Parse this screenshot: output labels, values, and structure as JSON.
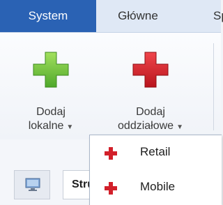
{
  "tabs": [
    "System",
    "Główne",
    "Sp"
  ],
  "ribbon": {
    "add_local": {
      "line1": "Dodaj",
      "line2": "lokalne",
      "arrow": "▼",
      "icon": "green-plus-icon"
    },
    "add_branch": {
      "line1": "Dodaj",
      "line2": "oddziałowe",
      "arrow": "▼",
      "icon": "red-plus-icon"
    }
  },
  "menu": {
    "items": [
      {
        "label": "Retail",
        "icon": "red-plus-icon"
      },
      {
        "label": "Mobile",
        "icon": "red-plus-icon"
      }
    ]
  },
  "lower_tabs": {
    "second_label": "Stru"
  },
  "colors": {
    "active_tab": "#2a62b4",
    "green_plus": "#6cc23a",
    "red_plus": "#d2202a"
  }
}
